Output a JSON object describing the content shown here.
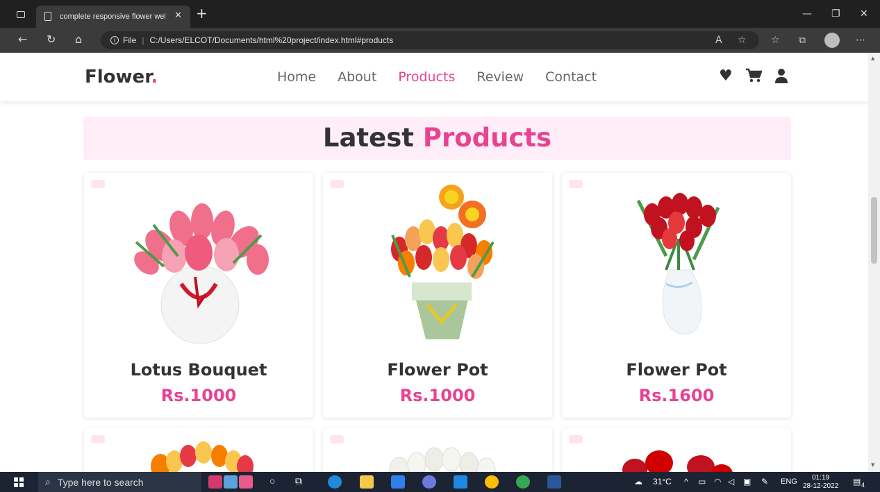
{
  "browser": {
    "tab_title": "complete responsive flower web·",
    "url_prefix": "File",
    "url": "C:/Users/ELCOT/Documents/html%20project/index.html#products"
  },
  "site": {
    "logo_text": "Flower",
    "logo_dot": ".",
    "menu": [
      {
        "label": "Home"
      },
      {
        "label": "About"
      },
      {
        "label": "Products"
      },
      {
        "label": "Review"
      },
      {
        "label": "Contact"
      }
    ],
    "active_menu": "Products",
    "accent_color": "#e84393"
  },
  "section": {
    "heading_main": "Latest",
    "heading_accent": "Products"
  },
  "products": [
    {
      "name": "Lotus Bouquet",
      "price": "Rs.1000"
    },
    {
      "name": "Flower Pot",
      "price": "Rs.1000"
    },
    {
      "name": "Flower Pot",
      "price": "Rs.1600"
    }
  ],
  "taskbar": {
    "search_placeholder": "Type here to search",
    "weather": "31°C",
    "language": "ENG",
    "time": "01:19",
    "date": "28-12-2022",
    "notifications": "4"
  }
}
